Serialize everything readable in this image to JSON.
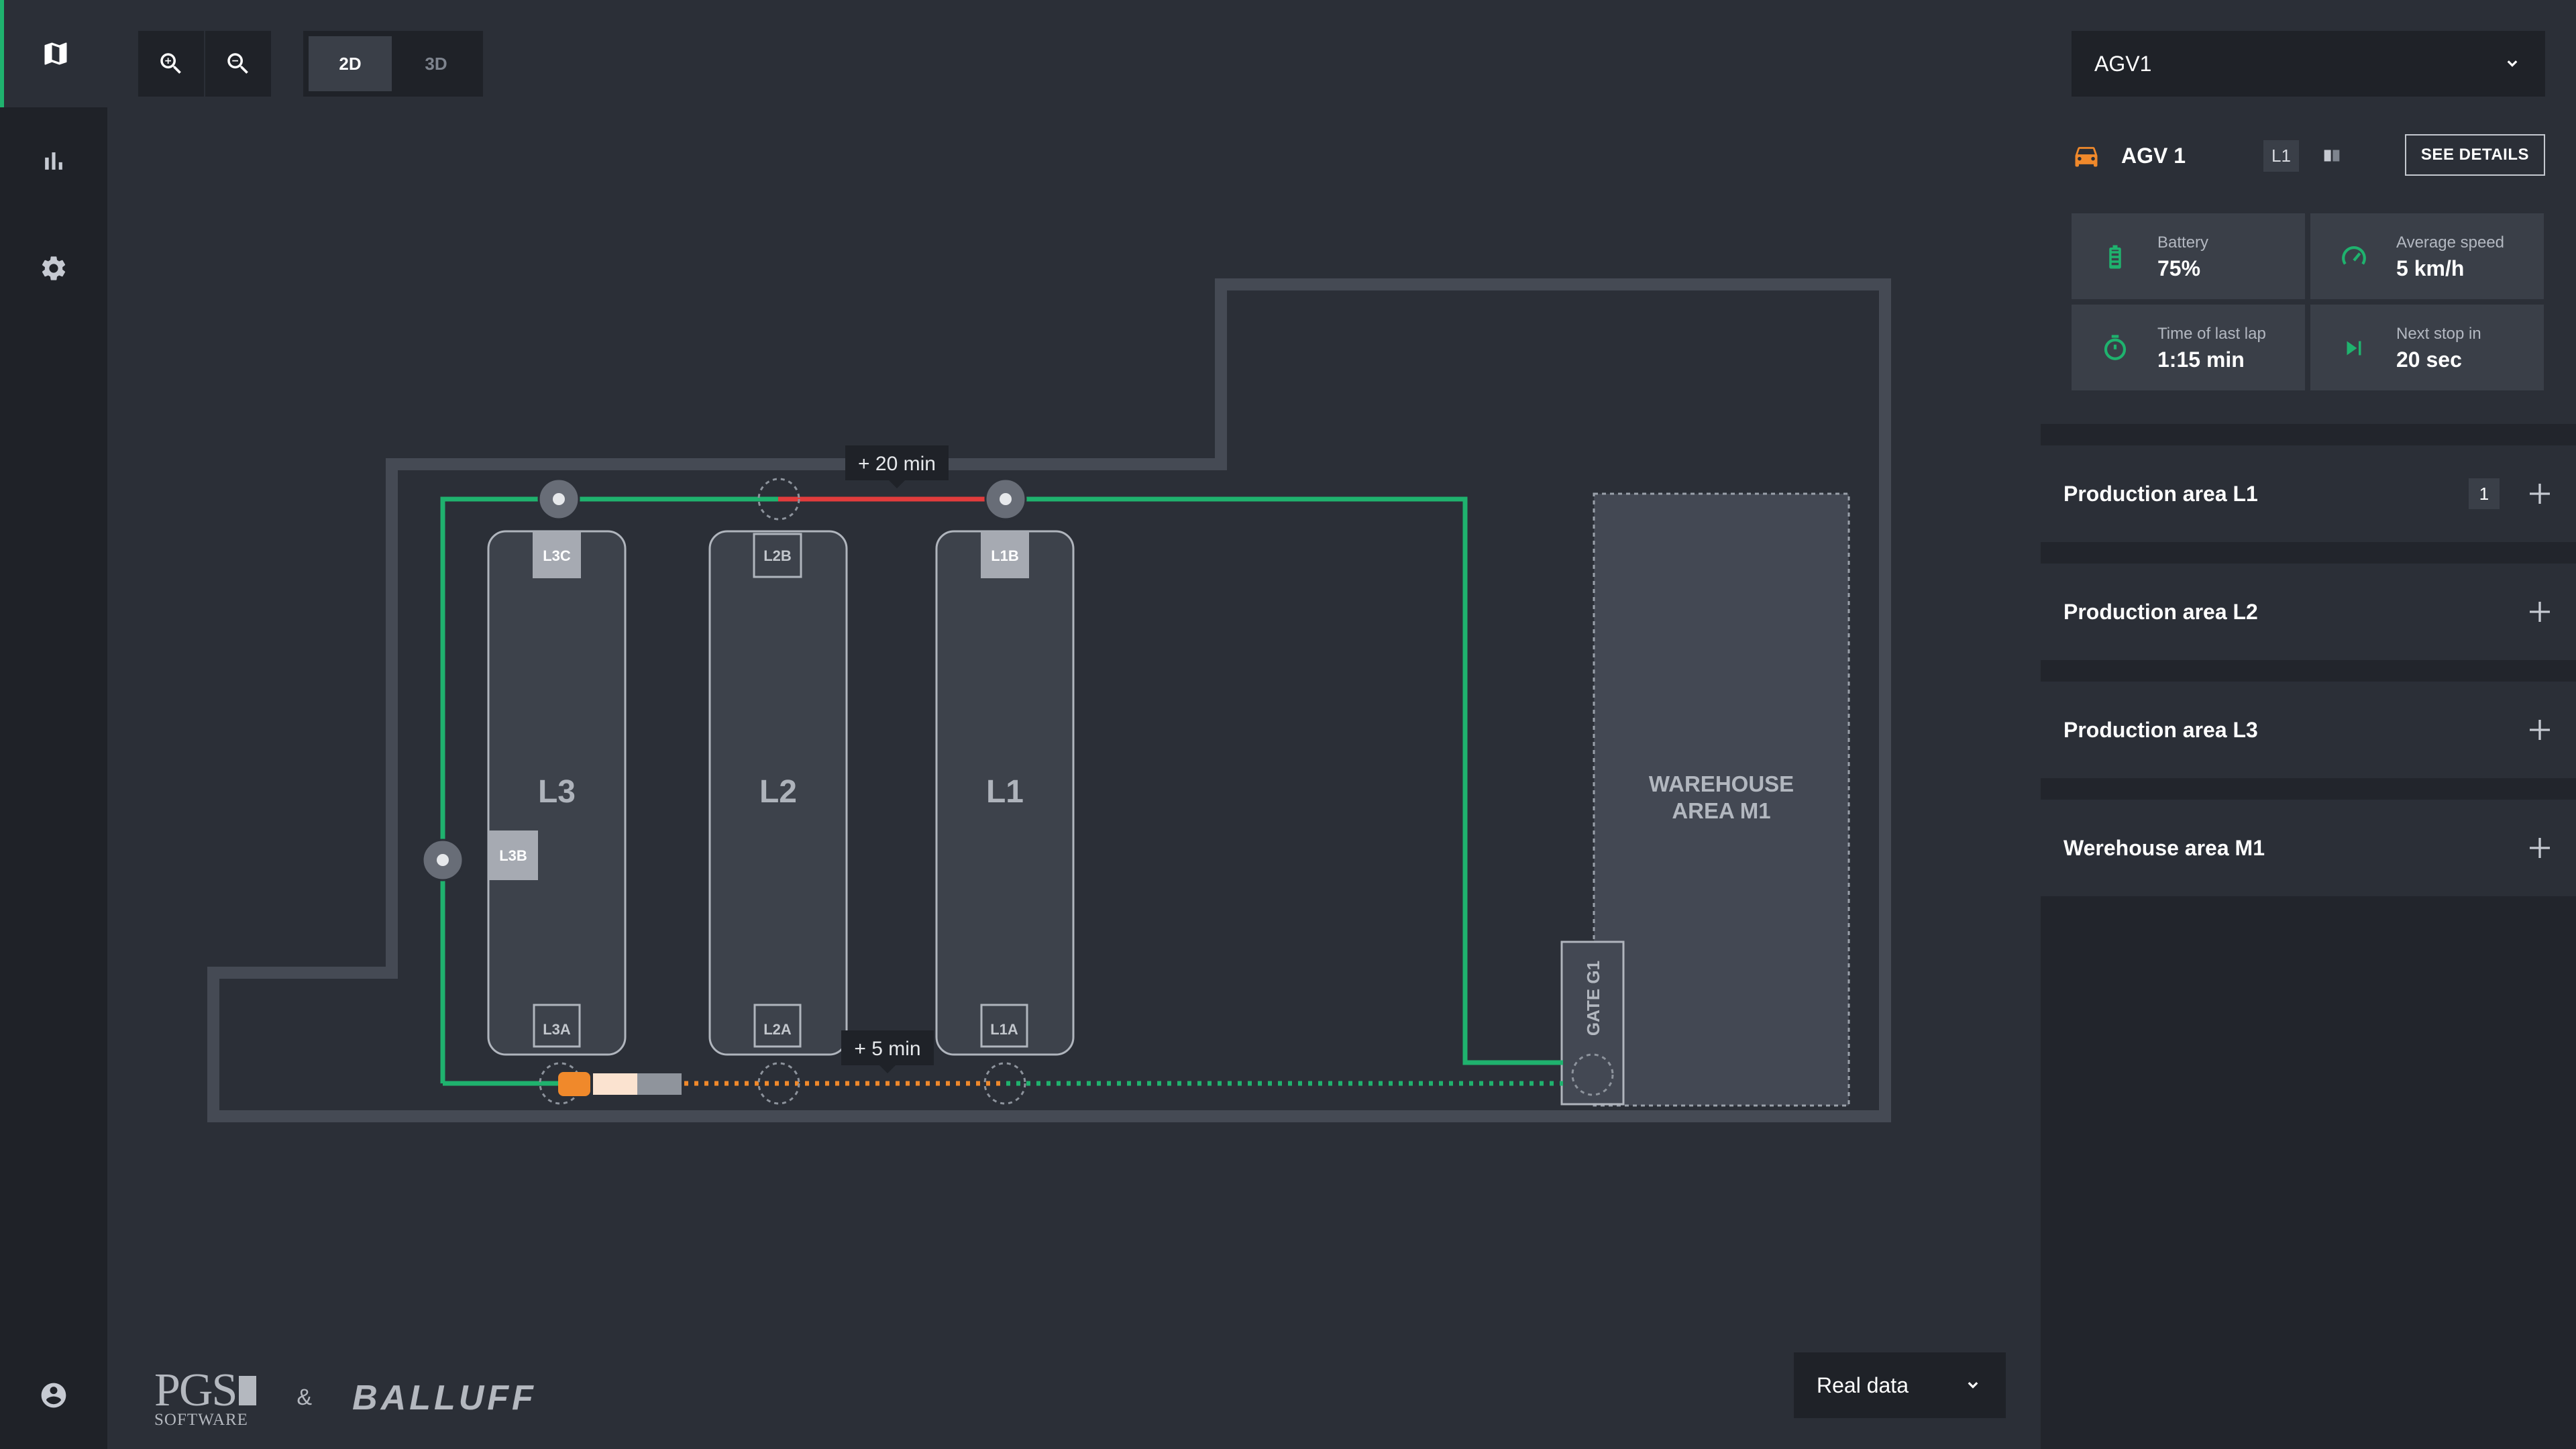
{
  "nav": {
    "items": [
      {
        "icon": "map-icon",
        "active": true
      },
      {
        "icon": "bar-chart-icon",
        "active": false
      },
      {
        "icon": "gear-icon",
        "active": false
      },
      {
        "icon": "user-icon",
        "active": false
      }
    ]
  },
  "toolbar": {
    "zoom_in_icon": "zoom-in-icon",
    "zoom_out_icon": "zoom-out-icon",
    "view_2d": "2D",
    "view_3d": "3D",
    "selected_view": "2D"
  },
  "map": {
    "lines": [
      {
        "name": "L3",
        "top_label": "L3C",
        "bottom_label": "L3A",
        "side_label": "L3B"
      },
      {
        "name": "L2",
        "top_label": "L2B",
        "bottom_label": "L2A"
      },
      {
        "name": "L1",
        "top_label": "L1B",
        "bottom_label": "L1A"
      }
    ],
    "warehouse_label_1": "WAREHOUSE",
    "warehouse_label_2": "AREA M1",
    "gate_label": "GATE G1",
    "delay_top": "+ 20 min",
    "delay_bottom": "+ 5 min",
    "colors": {
      "route": "#1fb26e",
      "delay": "#e23c3c",
      "planned": "#f0892b",
      "agv": "#f0892b"
    }
  },
  "branding": {
    "pgs_big": "PGS",
    "pgs_small": "SOFTWARE",
    "ampersand": "&",
    "balluff": "BALLUFF"
  },
  "data_mode": {
    "selected": "Real data"
  },
  "panel": {
    "agv_select": "AGV1",
    "agv_name": "AGV 1",
    "agv_tag": "L1",
    "see_details": "SEE DETAILS",
    "stats": [
      {
        "label": "Battery",
        "value": "75%",
        "icon": "battery-icon"
      },
      {
        "label": "Average speed",
        "value": "5 km/h",
        "icon": "speedometer-icon"
      },
      {
        "label": "Time of last lap",
        "value": "1:15 min",
        "icon": "timer-icon"
      },
      {
        "label": "Next stop in",
        "value": "20 sec",
        "icon": "skip-next-icon"
      }
    ],
    "areas": [
      {
        "name": "Production area L1",
        "count": "1"
      },
      {
        "name": "Production area L2"
      },
      {
        "name": "Production area L3"
      },
      {
        "name": "Werehouse area M1"
      }
    ]
  }
}
